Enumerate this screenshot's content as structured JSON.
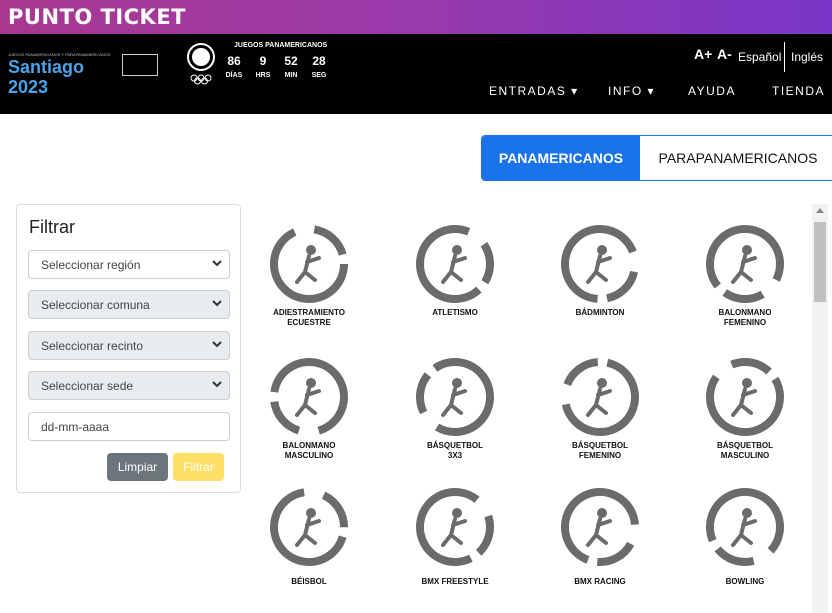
{
  "brand": "PUNTO TICKET",
  "header": {
    "games_small": "JUEGOS PANAMERICANOS Y PARAPANAMERICANOS",
    "games_name": "Santiago 2023",
    "countdown_title": "JUEGOS PANAMERICANOS",
    "countdown": [
      {
        "value": "86",
        "unit": "DÍAS"
      },
      {
        "value": "9",
        "unit": "HRS"
      },
      {
        "value": "52",
        "unit": "MIN"
      },
      {
        "value": "28",
        "unit": "SEG"
      }
    ],
    "font_increase": "A+",
    "font_decrease": "A-",
    "lang_es": "Español",
    "lang_en": "Inglés",
    "nav": [
      "ENTRADAS",
      "INFO",
      "AYUDA",
      "TIENDA"
    ]
  },
  "tabs": {
    "active": "PANAMERICANOS",
    "other": "PARAPANAMERICANOS"
  },
  "filter": {
    "title": "Filtrar",
    "region": "Seleccionar región",
    "comuna": "Seleccionar comuna",
    "recinto": "Seleccionar recinto",
    "sede": "Seleccionar sede",
    "date_placeholder": "dd-mm-aaaa",
    "clear": "Limpiar",
    "apply": "Filtrar"
  },
  "sports": [
    {
      "l1": "ADIESTRAMIENTO",
      "l2": "ECUESTRE"
    },
    {
      "l1": "ATLETISMO",
      "l2": ""
    },
    {
      "l1": "BÁDMINTON",
      "l2": ""
    },
    {
      "l1": "BALONMANO",
      "l2": "FEMENINO"
    },
    {
      "l1": "BALONMANO",
      "l2": "MASCULINO"
    },
    {
      "l1": "BÁSQUETBOL",
      "l2": "3X3"
    },
    {
      "l1": "BÁSQUETBOL",
      "l2": "FEMENINO"
    },
    {
      "l1": "BÁSQUETBOL",
      "l2": "MASCULINO"
    },
    {
      "l1": "BÉISBOL",
      "l2": ""
    },
    {
      "l1": "BMX FREESTYLE",
      "l2": ""
    },
    {
      "l1": "BMX RACING",
      "l2": ""
    },
    {
      "l1": "BOWLING",
      "l2": ""
    }
  ],
  "colors": {
    "brand_gradient_start": "#a8388f",
    "brand_gradient_end": "#7a36c8",
    "accent": "#1a73e8",
    "icon_gray": "#6b6b6b"
  }
}
